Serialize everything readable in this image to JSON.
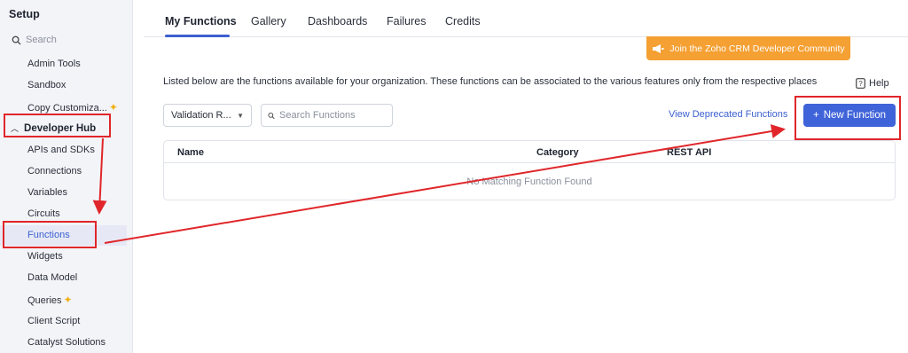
{
  "sidebar": {
    "title": "Setup",
    "search_placeholder": "Search",
    "items_top": [
      "Admin Tools",
      "Sandbox",
      "Copy Customiza..."
    ],
    "section": "Developer Hub",
    "items": [
      "APIs and SDKs",
      "Connections",
      "Variables",
      "Circuits",
      "Functions",
      "Widgets",
      "Data Model",
      "Queries",
      "Client Script",
      "Catalyst Solutions"
    ],
    "active_item": "Functions"
  },
  "tabs": [
    "My Functions",
    "Gallery",
    "Dashboards",
    "Failures",
    "Credits"
  ],
  "active_tab": "My Functions",
  "community_button": "Join the Zoho CRM Developer Community",
  "description": "Listed below are the functions available for your organization. These functions can be associated to the various features only from the respective places",
  "help_label": "Help",
  "filter": {
    "selected": "Validation R..."
  },
  "search": {
    "placeholder": "Search Functions"
  },
  "deprecated_link": "View Deprecated Functions",
  "new_function_button": "New Function",
  "table": {
    "columns": [
      "Name",
      "Category",
      "REST API"
    ],
    "empty_message": "No Matching Function Found"
  },
  "colors": {
    "accent": "#3f63d8",
    "community": "#f5a033",
    "annotation": "#e0262a"
  }
}
